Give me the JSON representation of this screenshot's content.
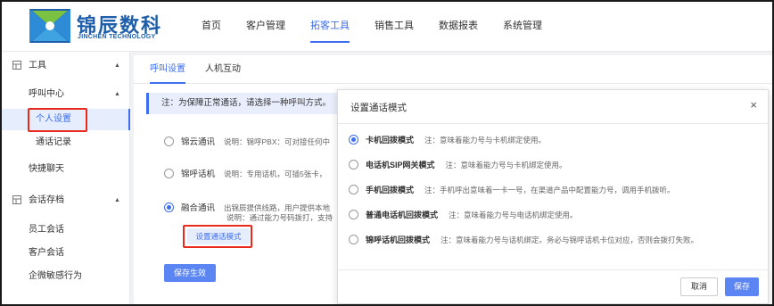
{
  "brand": {
    "name_cn": "锦辰数科",
    "name_en": "JINCHEN TECHNOLOGY",
    "primary_color": "#1f5ea8",
    "accent_color": "#3d6ef0"
  },
  "nav": [
    "首页",
    "客户管理",
    "拓客工具",
    "销售工具",
    "数据报表",
    "系统管理"
  ],
  "nav_active_index": 2,
  "sidebar": {
    "groups": [
      {
        "label": "工具",
        "icon": "tool-icon"
      },
      {
        "label": "会话存档",
        "icon": "archive-icon"
      }
    ],
    "subgroup": "呼叫中心",
    "items": [
      "个人设置",
      "通话记录",
      "快捷聊天",
      "员工会话",
      "客户会话",
      "企微敏感行为"
    ]
  },
  "tabs": [
    "呼叫设置",
    "人机互动"
  ],
  "notice": "注：为保障正常通话，请选择一种呼叫方式。",
  "options": [
    {
      "name": "锦云通讯",
      "desc": "说明：锦呼PBX：可对接任何中"
    },
    {
      "name": "锦呼话机",
      "desc": "说明：专用话机，可插5张卡，"
    },
    {
      "name": "融合通讯",
      "desc": "出锦辰提供线路，用户提供本地",
      "desc2": "说明：通过能力号码拨打，支持"
    }
  ],
  "set_mode_button": "设置通话模式",
  "save_effective_button": "保存生效",
  "modal": {
    "title": "设置通话模式",
    "close": "×",
    "options": [
      {
        "name": "卡机回拨模式",
        "desc": "注：意味着能力号与卡机绑定使用。",
        "checked": true
      },
      {
        "name": "电话机SIP网关模式",
        "desc": "注：意味着能力号与卡机绑定使用。",
        "checked": false
      },
      {
        "name": "手机回拨模式",
        "desc": "注：手机呼出意味着一卡一号，在渠道产品中配置能力号，调用手机拨听。",
        "checked": false
      },
      {
        "name": "普通电话机回拨模式",
        "desc": "注：意味着能力号与电话机绑定使用。",
        "checked": false
      },
      {
        "name": "锦呼话机回拨模式",
        "desc": "注：意味着能力号与话机绑定。务必与锦呼话机卡位对应，否则会拨打失败。",
        "checked": false
      }
    ],
    "cancel": "取消",
    "save": "保存"
  }
}
